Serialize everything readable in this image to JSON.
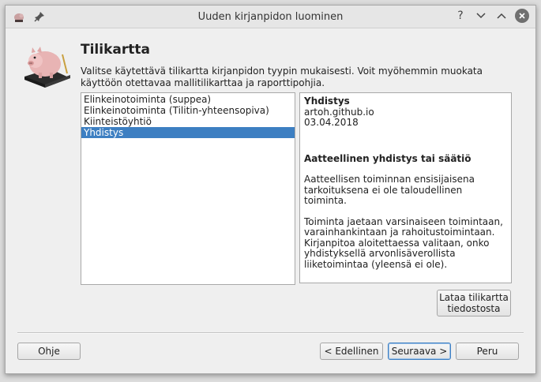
{
  "window": {
    "title": "Uuden kirjanpidon luominen"
  },
  "titlebar": {
    "app_icon": "piggy-bank-icon",
    "pin_icon": "pin-icon",
    "help_icon": "question-icon",
    "minimize_icon": "chevron-down-icon",
    "maximize_icon": "chevron-up-icon",
    "close_icon": "close-icon"
  },
  "page": {
    "icon": "piggy-bank-book-icon",
    "heading": "Tilikartta",
    "description": "Valitse käytettävä tilikartta kirjanpidon tyypin mukaisesti. Voit myöhemmin muokata käyttöön otettavaa mallitilikarttaa ja raporttipohjia."
  },
  "chart_list": {
    "items": [
      {
        "label": "Elinkeinotoiminta (suppea)",
        "selected": false
      },
      {
        "label": "Elinkeinotoiminta (Tilitin-yhteensopiva)",
        "selected": false
      },
      {
        "label": "Kiinteistöyhtiö",
        "selected": false
      },
      {
        "label": "Yhdistys",
        "selected": true
      }
    ]
  },
  "info": {
    "name": "Yhdistys",
    "author": "artoh.github.io",
    "date": "03.04.2018",
    "section_title": "Aatteellinen yhdistys tai säätiö",
    "para1": "Aatteellisen toiminnan ensisijaisena tarkoituksena ei ole taloudellinen toiminta.",
    "para2": "Toiminta jaetaan varsinaiseen toimintaan, varainhankintaan ja rahoitustoimintaan. Kirjanpitoa aloitettaessa valitaan, onko yhdistyksellä arvonlisäverollista liiketoimintaa (yleensä ei ole)."
  },
  "buttons": {
    "load_line1": "Lataa tilikartta",
    "load_line2": "tiedostosta",
    "help": "Ohje",
    "back": "< Edellinen",
    "next": "Seuraava >",
    "cancel": "Peru"
  },
  "colors": {
    "selection": "#3d7fc2",
    "window_bg": "#efefef"
  }
}
